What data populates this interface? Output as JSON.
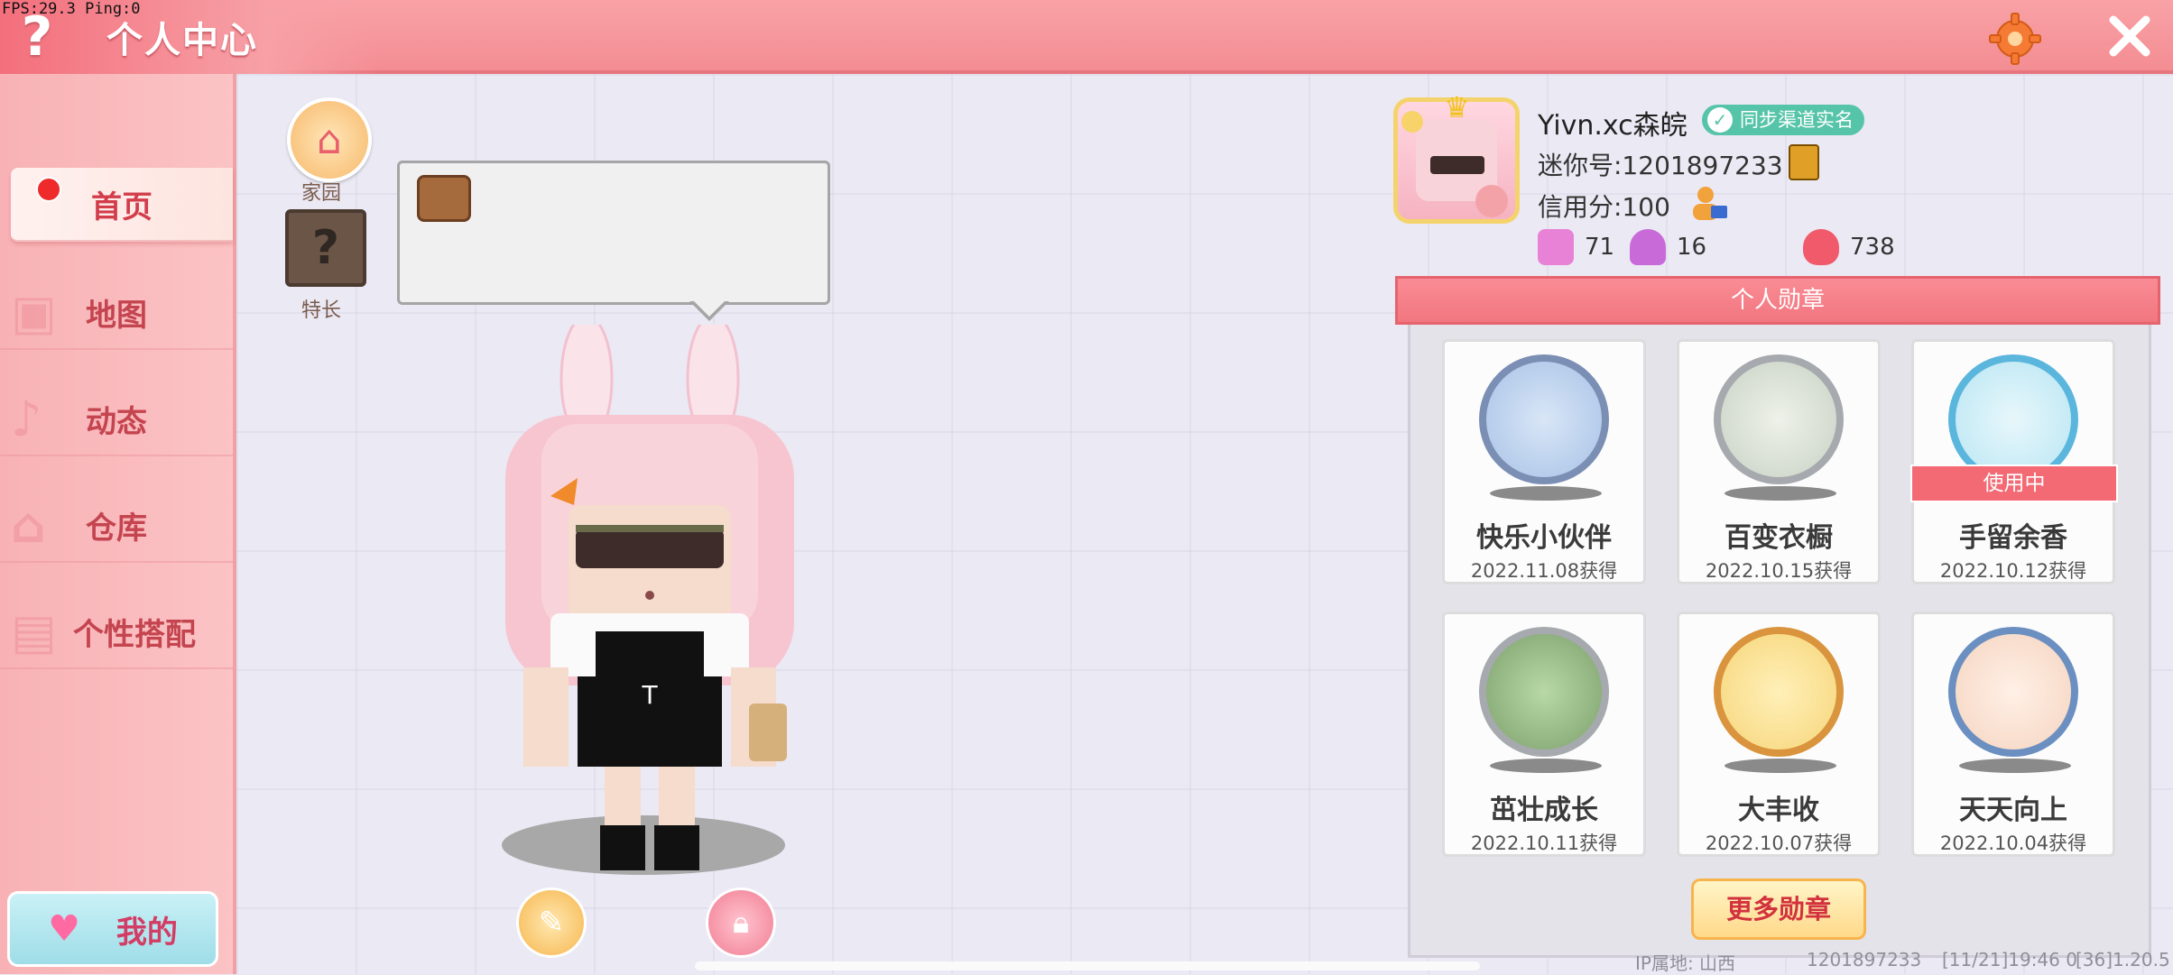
{
  "debug": {
    "fps": "FPS:29.3  Ping:0"
  },
  "header": {
    "title": "个人中心",
    "help_icon": "question-icon",
    "settings_icon": "gear-icon",
    "close_icon": "close-icon"
  },
  "sidebar": {
    "items": [
      {
        "label": "首页",
        "icon": "home-tab-icon",
        "active": true
      },
      {
        "label": "地图",
        "icon": "map-icon"
      },
      {
        "label": "动态",
        "icon": "bell-icon"
      },
      {
        "label": "仓库",
        "icon": "warehouse-icon"
      },
      {
        "label": "个性搭配",
        "icon": "outfit-icon"
      }
    ],
    "my_button": "我的"
  },
  "left_actions": {
    "home_label": "家园",
    "skill_label": "特长",
    "skill_glyph": "?"
  },
  "profile": {
    "username": "Yivn.xc森皖",
    "verify_label": "同步渠道实名",
    "mini_id": "迷你号:1201897233",
    "credit": "信用分:100",
    "stats": [
      {
        "value": "71",
        "icon": "bookmark-plus-icon",
        "color": "#e882d6"
      },
      {
        "value": "16",
        "icon": "fans-icon",
        "color": "#c96ad9"
      },
      {
        "value": "738",
        "icon": "flame-icon",
        "color": "#f05a6a"
      }
    ]
  },
  "badges": {
    "header": "个人勋章",
    "in_use_label": "使用中",
    "more_label": "更多勋章",
    "items": [
      {
        "name": "快乐小伙伴",
        "date": "2022.11.08获得",
        "ring": "#7b8fb5",
        "fill": "#a7c2e6"
      },
      {
        "name": "百变衣橱",
        "date": "2022.10.15获得",
        "ring": "#a6a9ae",
        "fill": "#c8d1c4"
      },
      {
        "name": "手留余香",
        "date": "2022.10.12获得",
        "ring": "#5bb6dd",
        "fill": "#b9e6f3",
        "in_use": true
      },
      {
        "name": "茁壮成长",
        "date": "2022.10.11获得",
        "ring": "#a6a9ae",
        "fill": "#7ca06c"
      },
      {
        "name": "大丰收",
        "date": "2022.10.07获得",
        "ring": "#d9943d",
        "fill": "#f6d57a"
      },
      {
        "name": "天天向上",
        "date": "2022.10.04获得",
        "ring": "#6b8fc1",
        "fill": "#f5d4c0"
      }
    ]
  },
  "footer": {
    "ip": "IP属地: 山西",
    "uid": "1201897233",
    "time": "[11/21]19:46 0",
    "version": "[36]1.20.5"
  }
}
